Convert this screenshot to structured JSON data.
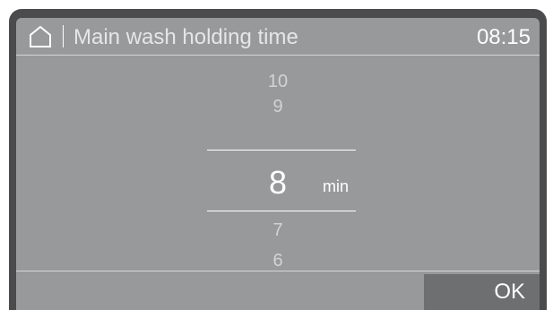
{
  "header": {
    "home_icon": "home-icon",
    "title": "Main wash holding time",
    "clock": "08:15"
  },
  "picker": {
    "values_above": [
      "10",
      "9"
    ],
    "selected_value": "8",
    "unit": "min",
    "values_below": [
      "7",
      "6"
    ]
  },
  "footer": {
    "ok_label": "OK"
  },
  "colors": {
    "bezel": "#4b4b4d",
    "screen_background": "#98999b",
    "ok_button_background": "#6e6f71",
    "text_primary": "#ffffff",
    "text_dimmed": "#d2d3d4"
  }
}
